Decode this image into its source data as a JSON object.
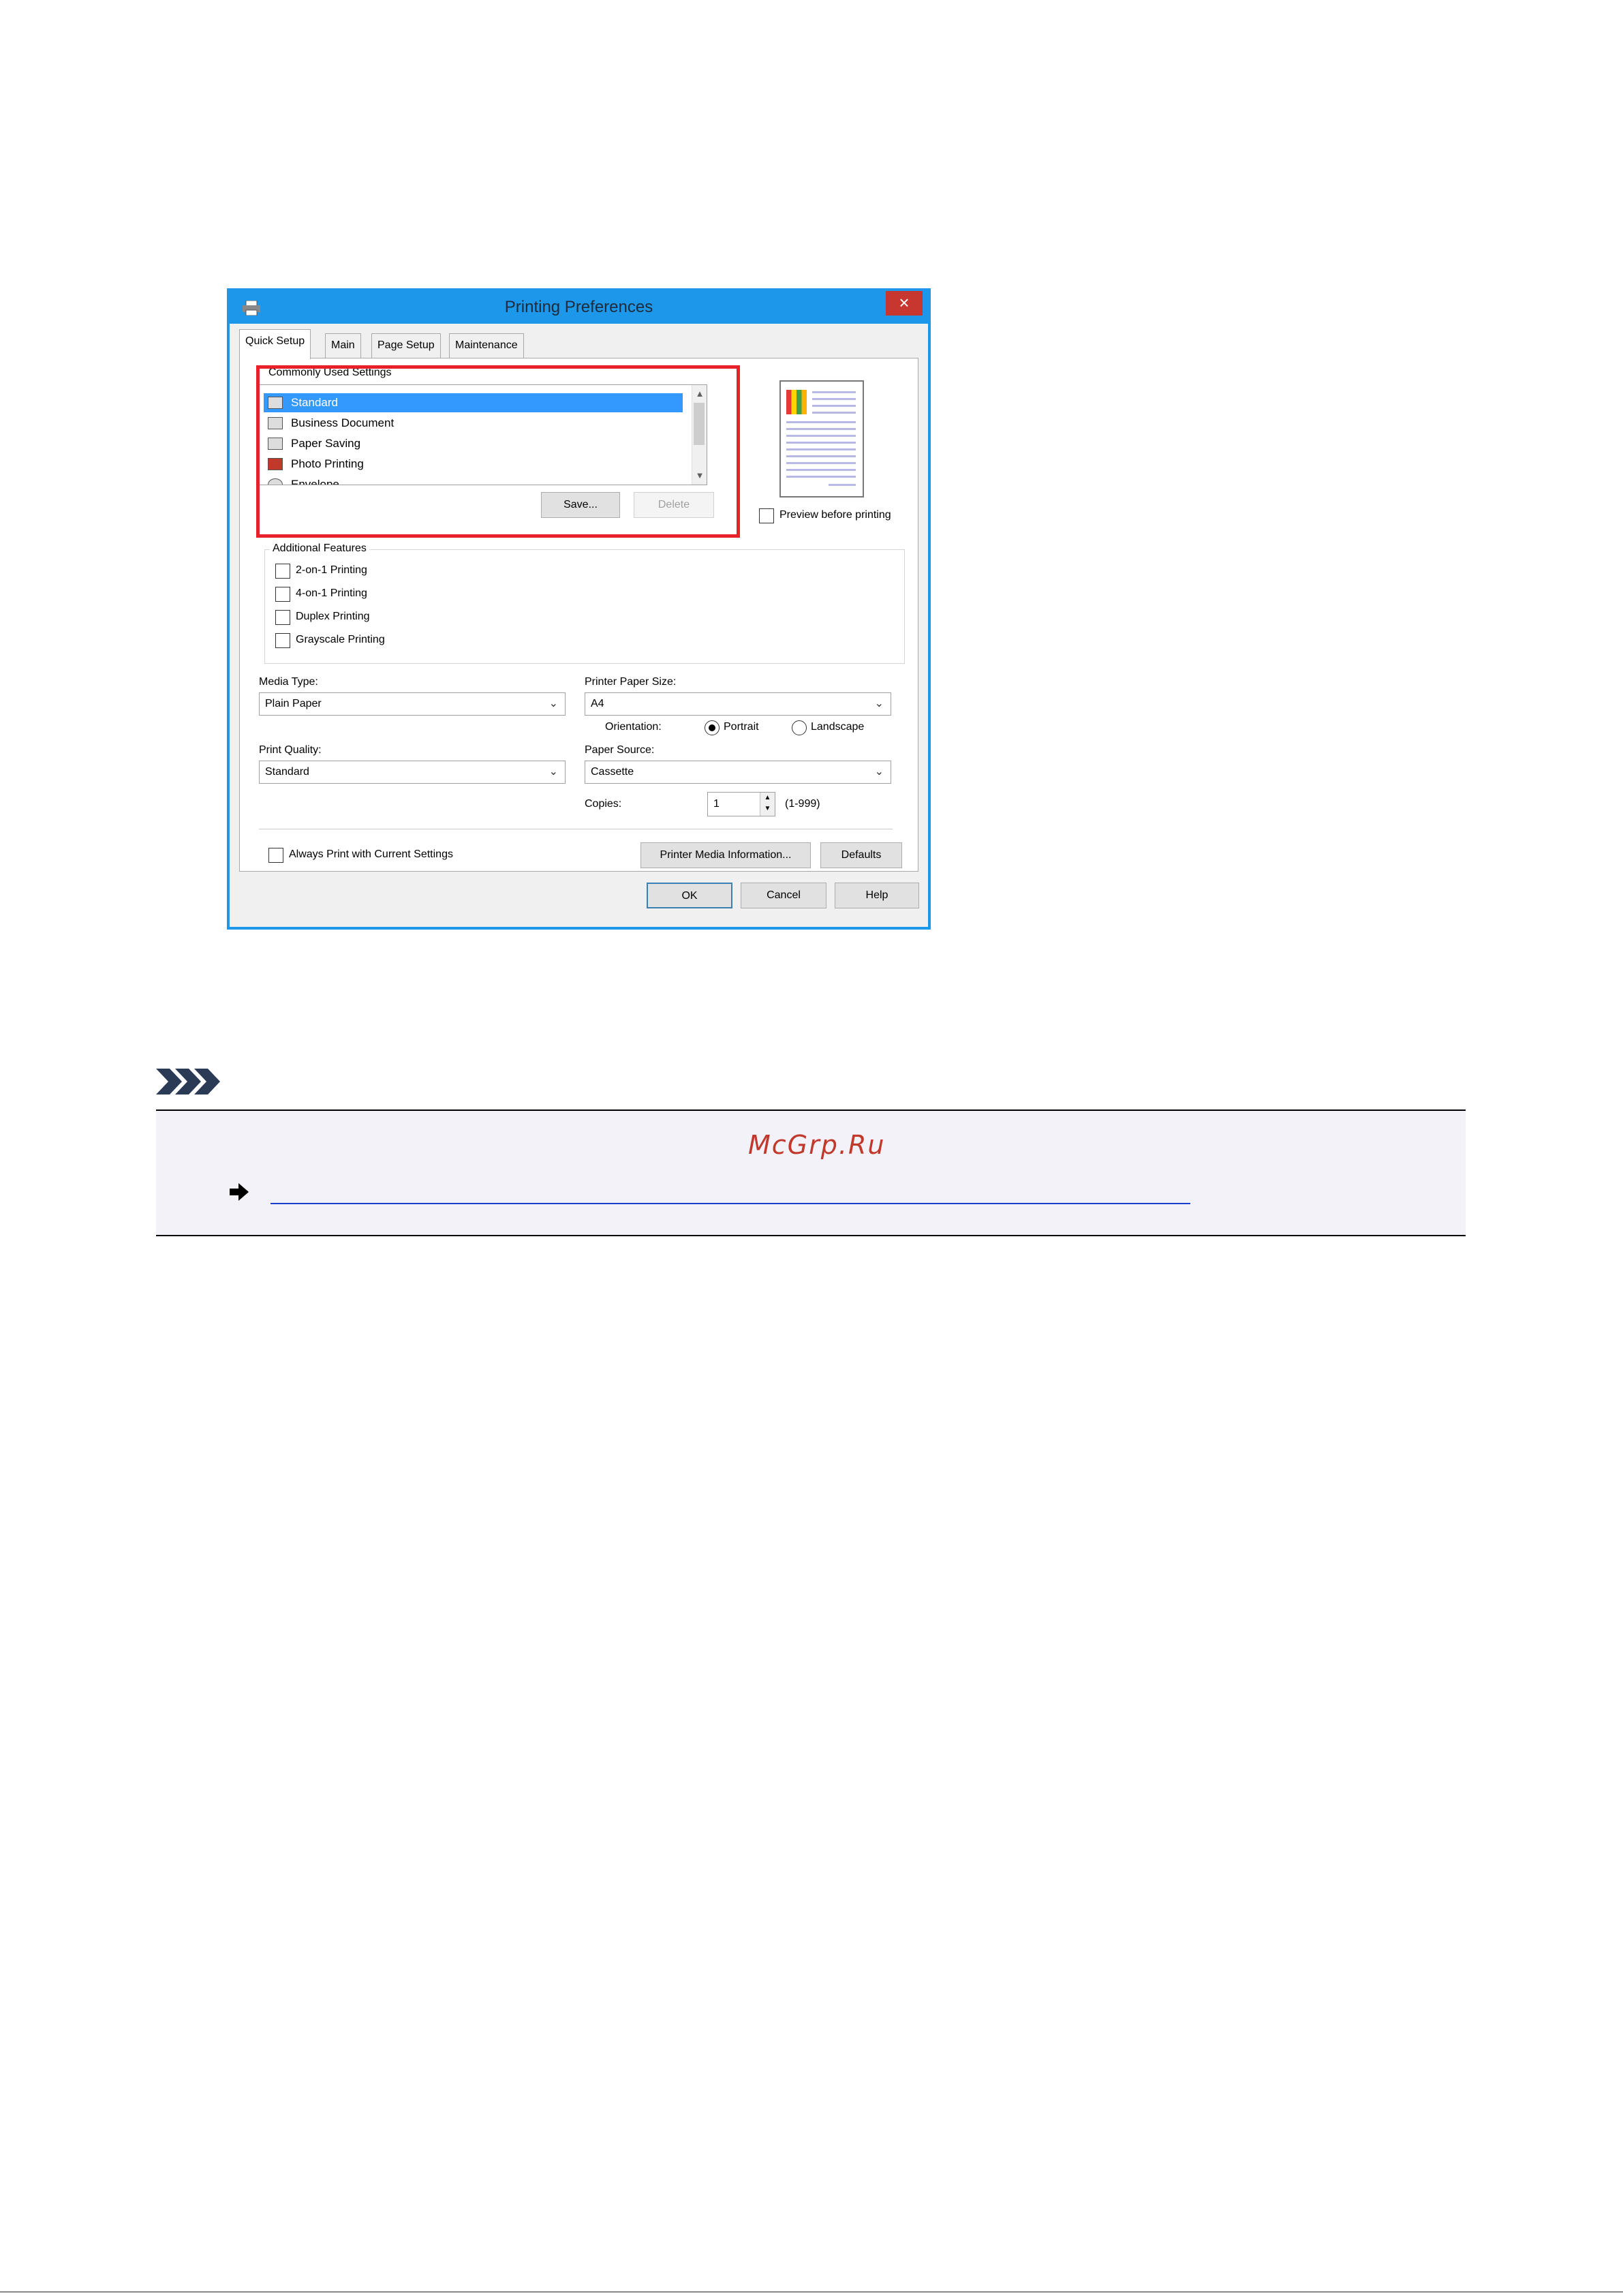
{
  "dialog": {
    "title": "Printing Preferences",
    "close_label": "×",
    "tabs": [
      {
        "label": "Quick Setup"
      },
      {
        "label": "Main"
      },
      {
        "label": "Page Setup"
      },
      {
        "label": "Maintenance"
      }
    ],
    "commonly_used": {
      "label": "Commonly Used Settings",
      "items": [
        {
          "label": "Standard",
          "selected": true
        },
        {
          "label": "Business Document"
        },
        {
          "label": "Paper Saving"
        },
        {
          "label": "Photo Printing"
        },
        {
          "label": "Envelope"
        }
      ],
      "save_label": "Save...",
      "delete_label": "Delete"
    },
    "preview_label": "Preview before printing",
    "additional_features": {
      "label": "Additional Features",
      "options": [
        {
          "label": "2-on-1 Printing"
        },
        {
          "label": "4-on-1 Printing"
        },
        {
          "label": "Duplex Printing"
        },
        {
          "label": "Grayscale Printing"
        }
      ]
    },
    "media_type": {
      "label": "Media Type:",
      "value": "Plain Paper"
    },
    "printer_paper_size": {
      "label": "Printer Paper Size:",
      "value": "A4"
    },
    "orientation": {
      "label": "Orientation:",
      "portrait": "Portrait",
      "landscape": "Landscape"
    },
    "print_quality": {
      "label": "Print Quality:",
      "value": "Standard"
    },
    "paper_source": {
      "label": "Paper Source:",
      "value": "Cassette"
    },
    "copies": {
      "label": "Copies:",
      "value": "1",
      "range": "(1-999)"
    },
    "always_print_label": "Always Print with Current Settings",
    "media_info_label": "Printer Media Information...",
    "defaults_label": "Defaults",
    "ok_label": "OK",
    "cancel_label": "Cancel",
    "help_label": "Help"
  },
  "note": {
    "watermark": "McGrp.Ru"
  },
  "colors": {
    "accent": "#1c97ea",
    "highlight": "#e8202a",
    "selection": "#3399ff",
    "watermark": "#c0392b",
    "link": "#1a3fcc"
  }
}
